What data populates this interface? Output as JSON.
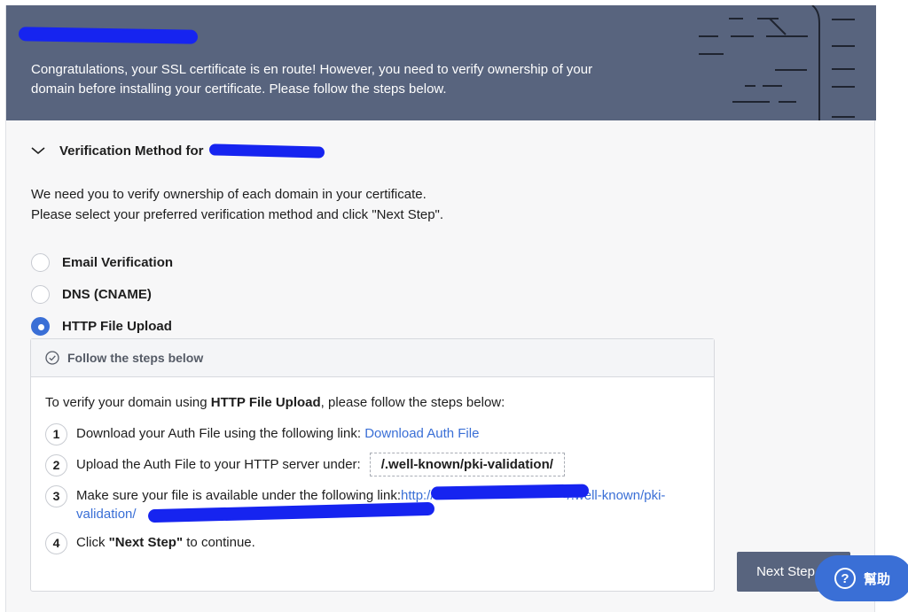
{
  "banner": {
    "message": "Congratulations, your SSL certificate is en route! However, you need to verify ownership of your domain before installing your certificate. Please follow the steps below."
  },
  "section": {
    "title": "Verification Method for"
  },
  "intro": {
    "line1": "We need you to verify ownership of each domain in your certificate.",
    "line2": "Please select your preferred verification method and click \"Next Step\"."
  },
  "methods": [
    {
      "label": "Email Verification",
      "selected": false
    },
    {
      "label": "DNS (CNAME)",
      "selected": false
    },
    {
      "label": "HTTP File Upload",
      "selected": true
    }
  ],
  "steps_panel": {
    "header": "Follow the steps below",
    "lead_prefix": "To verify your domain using ",
    "lead_bold": "HTTP File Upload",
    "lead_suffix": ", please follow the steps below:",
    "steps": [
      {
        "num": "1",
        "text": "Download your Auth File using the following link:",
        "link": "Download Auth File"
      },
      {
        "num": "2",
        "text": "Upload the Auth File to your HTTP server under:",
        "path": "/.well-known/pki-validation/"
      },
      {
        "num": "3",
        "text": "Make sure your file is available under the following link:",
        "link_part1": "http://",
        "link_part2": "/.well-known/pki-",
        "link_part3": "validation/"
      },
      {
        "num": "4",
        "text_prefix": "Click ",
        "text_bold": "\"Next Step\"",
        "text_suffix": " to continue."
      }
    ]
  },
  "buttons": {
    "next_step": "Next Step",
    "help": "幫助"
  },
  "colors": {
    "banner_bg": "#58647e",
    "accent": "#3a6fd6",
    "redaction": "#1624f0"
  },
  "icons": {
    "section_toggle": "chevron-down-icon",
    "steps_header": "check-circle-icon",
    "help": "question-mark-icon"
  }
}
